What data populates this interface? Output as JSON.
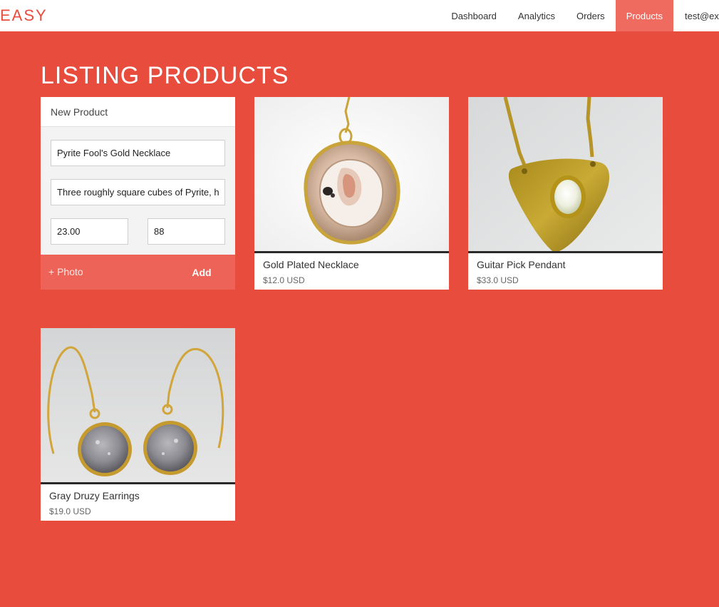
{
  "brand": {
    "logo": "EASY",
    "accent": "#e84c3d",
    "accent_light": "#ef6b5f"
  },
  "nav": {
    "items": [
      {
        "label": "Dashboard",
        "active": false
      },
      {
        "label": "Analytics",
        "active": false
      },
      {
        "label": "Orders",
        "active": false
      },
      {
        "label": "Products",
        "active": true
      }
    ],
    "user": "test@ex"
  },
  "page": {
    "title": "LISTING PRODUCTS"
  },
  "new_product_form": {
    "header": "New Product",
    "name_value": "Pyrite Fool's Gold Necklace",
    "description_value": "Three roughly square cubes of Pyrite, hung from a gold chain",
    "price_value": "23.00",
    "quantity_value": "88",
    "photo_label": "+ Photo",
    "add_label": "Add"
  },
  "products": [
    {
      "name": "Gold Plated Necklace",
      "price": "$12.0 USD",
      "image_icon": "geode-necklace-photo"
    },
    {
      "name": "Guitar Pick Pendant",
      "price": "$33.0 USD",
      "image_icon": "guitar-pick-pendant-photo"
    },
    {
      "name": "Gray Druzy Earrings",
      "price": "$19.0 USD",
      "image_icon": "druzy-earrings-photo"
    }
  ]
}
